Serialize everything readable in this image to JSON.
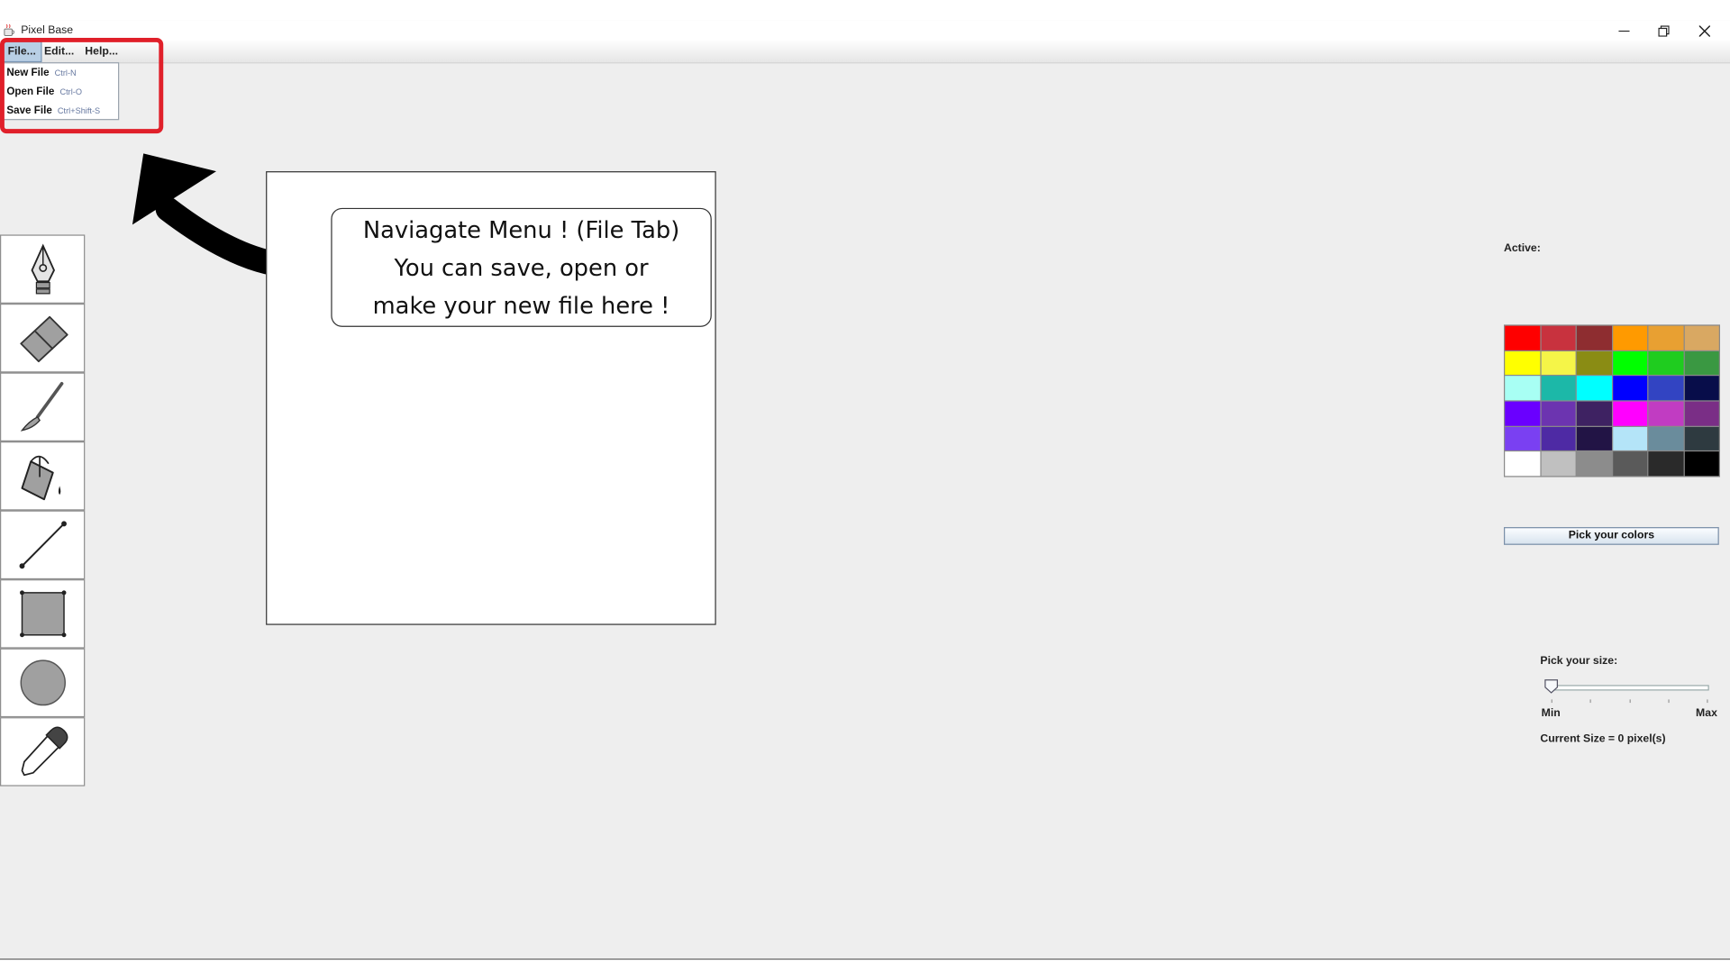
{
  "window": {
    "title": "Pixel Base",
    "controls": [
      "minimize-icon",
      "restore-icon",
      "close-icon"
    ]
  },
  "menubar": {
    "items": [
      {
        "label": "File..."
      },
      {
        "label": "Edit..."
      },
      {
        "label": "Help..."
      }
    ],
    "open_menu": "File..."
  },
  "file_menu": {
    "items": [
      {
        "label": "New File",
        "shortcut": "Ctrl-N"
      },
      {
        "label": "Open File",
        "shortcut": "Ctrl-O"
      },
      {
        "label": "Save File",
        "shortcut": "Ctrl+Shift-S"
      }
    ]
  },
  "callout": {
    "lines": [
      "Naviagate Menu ! (File Tab)",
      "You can save, open or",
      "make your new file here !"
    ],
    "highlight_color": "#e0202a"
  },
  "tools": [
    {
      "icon": "pen-nib-icon"
    },
    {
      "icon": "eraser-icon"
    },
    {
      "icon": "brush-icon"
    },
    {
      "icon": "paint-bucket-icon"
    },
    {
      "icon": "line-icon"
    },
    {
      "icon": "rectangle-icon"
    },
    {
      "icon": "circle-icon"
    },
    {
      "icon": "eyedropper-icon"
    }
  ],
  "color_panel": {
    "active_label": "Active:",
    "swatches": [
      "#fe0000",
      "#c8323e",
      "#8e2d30",
      "#ff9a00",
      "#e8a032",
      "#d9a862",
      "#ffff00",
      "#f5f548",
      "#8a8c14",
      "#00ff00",
      "#1fcc1f",
      "#3a9842",
      "#a8fff4",
      "#1cb8a8",
      "#00ffff",
      "#0000ff",
      "#3244c2",
      "#080d4a",
      "#6a00ff",
      "#6c34b0",
      "#3e2262",
      "#ff00ff",
      "#c13cc2",
      "#7a2e86",
      "#7a40f2",
      "#4e2aa4",
      "#221445",
      "#b4e4f8",
      "#6a8c9c",
      "#2e3a40",
      "#ffffff",
      "#c0c0c0",
      "#8c8c8c",
      "#5a5a5a",
      "#2a2a2a",
      "#000000"
    ],
    "pick_button": "Pick your colors"
  },
  "size_panel": {
    "label": "Pick your size:",
    "min_label": "Min",
    "max_label": "Max",
    "current": "Current Size = 0 pixel(s)",
    "value_fraction": 0.0
  }
}
